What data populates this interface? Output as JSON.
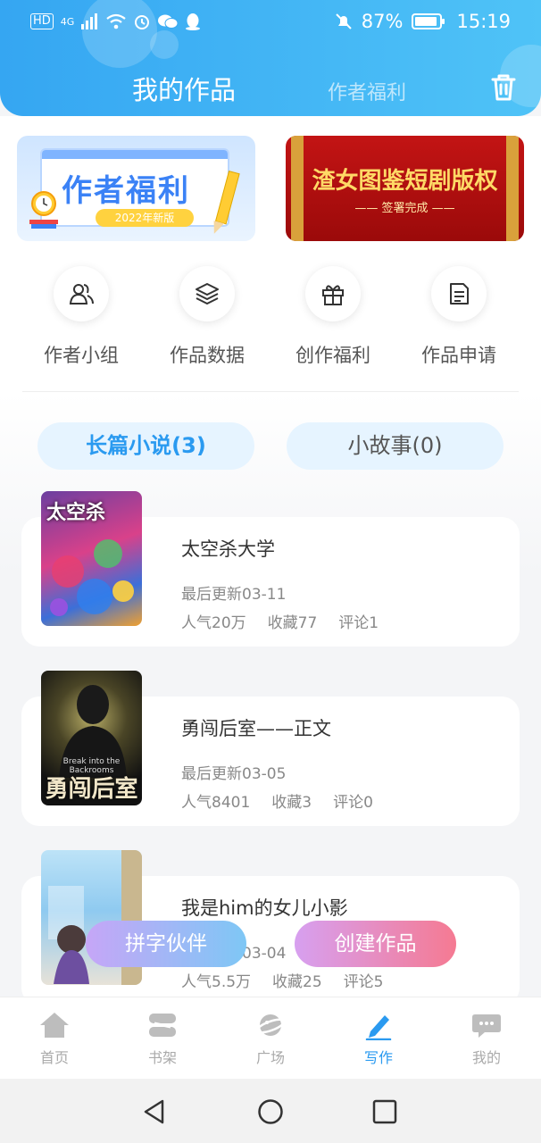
{
  "status_bar": {
    "left_icons": [
      "HD",
      "4G"
    ],
    "battery": "87%",
    "time": "15:19"
  },
  "header": {
    "tab_active": "我的作品",
    "tab_inactive": "作者福利"
  },
  "banners": {
    "left": {
      "title": "作者福利",
      "badge": "2022年新版"
    },
    "right": {
      "title": "渣女图鉴短剧版权",
      "subtitle": "—— 签署完成 ——"
    }
  },
  "quick_actions": [
    {
      "label": "作者小组",
      "icon": "users-icon"
    },
    {
      "label": "作品数据",
      "icon": "layers-icon"
    },
    {
      "label": "创作福利",
      "icon": "gift-icon"
    },
    {
      "label": "作品申请",
      "icon": "document-icon"
    }
  ],
  "segments": {
    "long": "长篇小说(3)",
    "short": "小故事(0)"
  },
  "works": [
    {
      "title": "太空杀大学",
      "updated": "最后更新03-11",
      "popularity": "人气20万",
      "favorites": "收藏77",
      "comments": "评论1",
      "cover_text": "太空杀"
    },
    {
      "title": "勇闯后室——正文",
      "updated": "最后更新03-05",
      "popularity": "人气8401",
      "favorites": "收藏3",
      "comments": "评论0",
      "cover_sub": "Break into the Backrooms",
      "cover_text": "勇闯后室"
    },
    {
      "title": "我是him的女儿小影",
      "updated": "最后更新03-04",
      "popularity": "人气5.5万",
      "favorites": "收藏25",
      "comments": "评论5"
    }
  ],
  "fabs": {
    "partner": "拼字伙伴",
    "create": "创建作品"
  },
  "tabbar": [
    {
      "label": "首页",
      "icon": "home-icon"
    },
    {
      "label": "书架",
      "icon": "bookshelf-icon"
    },
    {
      "label": "广场",
      "icon": "planet-icon"
    },
    {
      "label": "写作",
      "icon": "pen-icon",
      "active": true
    },
    {
      "label": "我的",
      "icon": "chat-icon"
    }
  ],
  "colors": {
    "accent": "#2a9af0",
    "header_start": "#35a6f2",
    "header_end": "#4fc3f7"
  }
}
